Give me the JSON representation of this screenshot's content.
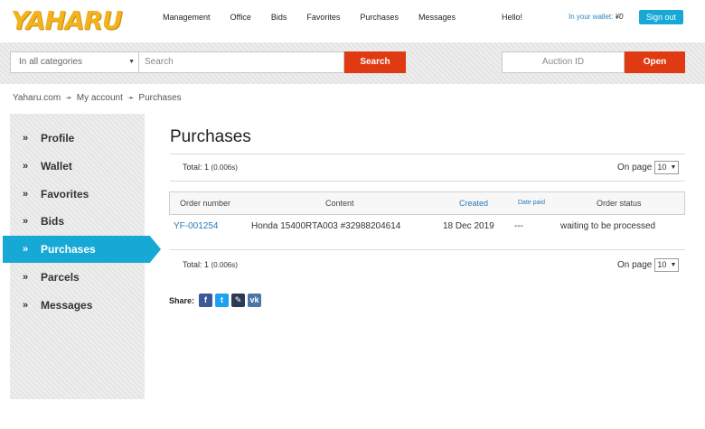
{
  "header": {
    "logo": "YAHARU",
    "nav": [
      "Management",
      "Office",
      "Bids",
      "Favorites",
      "Purchases",
      "Messages"
    ],
    "hello": "Hello!",
    "wallet_label": "In your wallet:",
    "wallet_value": "¥0",
    "signout": "Sign out"
  },
  "search": {
    "category": "In all categories",
    "placeholder": "Search",
    "button": "Search",
    "auction_placeholder": "Auction ID",
    "open_button": "Open"
  },
  "breadcrumb": [
    "Yaharu.com",
    "My account",
    "Purchases"
  ],
  "sidebar": {
    "items": [
      {
        "label": "Profile"
      },
      {
        "label": "Wallet"
      },
      {
        "label": "Favorites"
      },
      {
        "label": "Bids"
      },
      {
        "label": "Purchases"
      },
      {
        "label": "Parcels"
      },
      {
        "label": "Messages"
      }
    ],
    "active": "Purchases"
  },
  "main": {
    "title": "Purchases",
    "total": "Total: 1",
    "total_time": "(0.006s)",
    "onpage_label": "On page",
    "onpage_value": "10",
    "columns": [
      "Order number",
      "Content",
      "Created",
      "Date paid",
      "Order status"
    ],
    "rows": [
      {
        "order": "YF-001254",
        "content": "Honda 15400RTA003 #32988204614",
        "created": "18 Dec 2019",
        "paid": "---",
        "status": "waiting to be processed"
      }
    ],
    "share_label": "Share:"
  },
  "colors": {
    "accent": "#16a9d6",
    "action": "#e03a12",
    "logo": "#f2b31e",
    "link": "#2a7ab8"
  }
}
